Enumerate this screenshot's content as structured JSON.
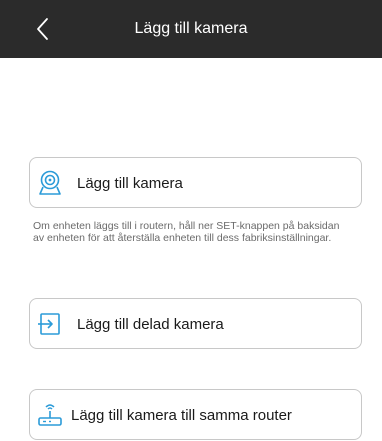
{
  "header": {
    "title": "Lägg till kamera",
    "back_icon": "chevron-left-icon",
    "background": "#2b2b2b"
  },
  "options": [
    {
      "label": "Lägg till kamera",
      "icon": "camera-target-icon"
    },
    {
      "label": "Lägg till delad kamera",
      "icon": "share-enter-icon"
    },
    {
      "label": "Lägg till kamera till samma router",
      "icon": "router-icon"
    }
  ],
  "hint_text": "Om enheten läggs till i routern, håll ner SET-knappen på baksidan av enheten för att återställa enheten till dess fabriksinställningar.",
  "accent_color": "#2b9bd8"
}
